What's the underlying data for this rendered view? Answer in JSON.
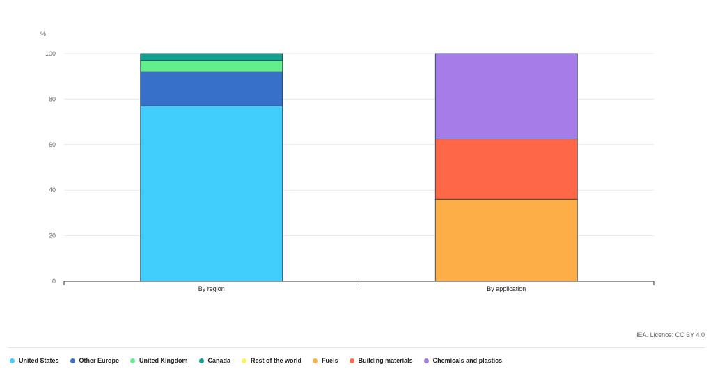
{
  "chart_data": {
    "type": "bar",
    "stacked": true,
    "ylabel": "%",
    "ylim": [
      0,
      100
    ],
    "yticks": [
      0,
      20,
      40,
      60,
      80,
      100
    ],
    "grid": true,
    "categories": [
      "By region",
      "By application"
    ],
    "series": [
      {
        "name": "United States",
        "color": "#41cefc",
        "values": [
          77,
          0
        ]
      },
      {
        "name": "Other Europe",
        "color": "#3770c9",
        "values": [
          15,
          0
        ]
      },
      {
        "name": "United Kingdom",
        "color": "#62ef8b",
        "values": [
          5,
          0
        ]
      },
      {
        "name": "Canada",
        "color": "#13a08e",
        "values": [
          3,
          0
        ]
      },
      {
        "name": "Rest of the world",
        "color": "#fff15a",
        "values": [
          0,
          0
        ]
      },
      {
        "name": "Fuels",
        "color": "#feae47",
        "values": [
          0,
          36
        ]
      },
      {
        "name": "Building materials",
        "color": "#fe6848",
        "values": [
          0,
          26.5
        ]
      },
      {
        "name": "Chemicals and plastics",
        "color": "#a67ce8",
        "values": [
          0,
          37.5
        ]
      }
    ],
    "legend_position": "bottom-left"
  },
  "credit": "IEA. Licence: CC BY 4.0"
}
